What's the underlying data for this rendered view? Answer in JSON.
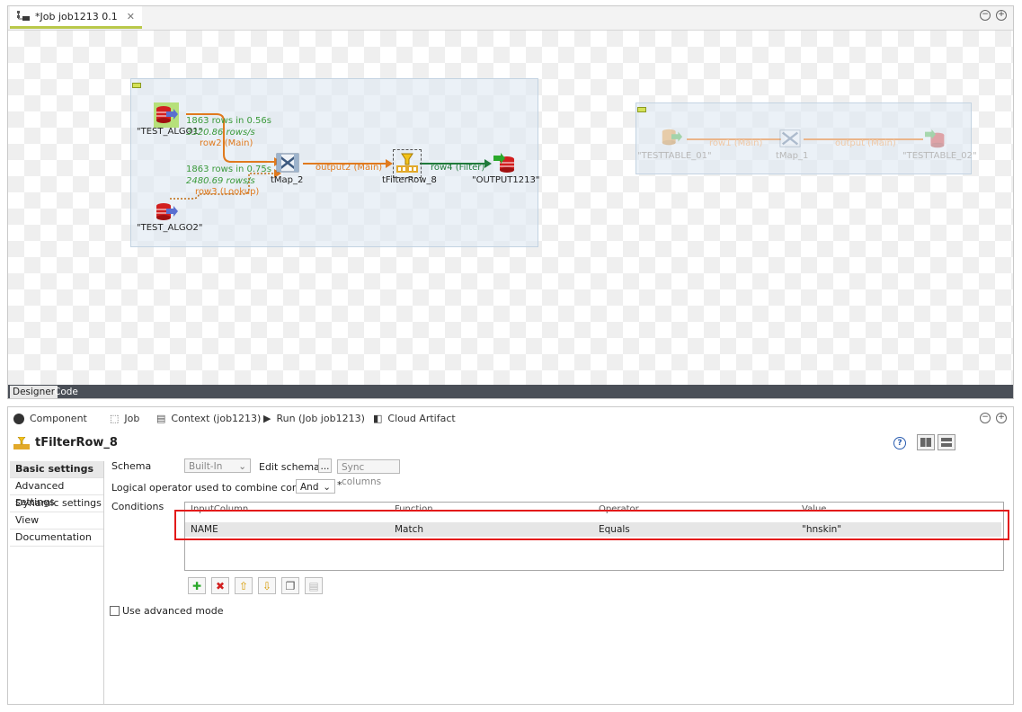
{
  "editor": {
    "tab_title": "*Job job1213 0.1",
    "bottom_tabs": [
      "Designer",
      "Code"
    ]
  },
  "job": {
    "nodes": {
      "test_algo1": "\"TEST_ALGO1\"",
      "test_algo2": "\"TEST_ALGO2\"",
      "tmap2": "tMap_2",
      "tfilterrow8": "tFilterRow_8",
      "output1213": "\"OUTPUT1213\"",
      "testtable01": "\"TESTTABLE_01\"",
      "tmap1": "tMap_1",
      "testtable02": "\"TESTTABLE_02\""
    },
    "flows": {
      "row2_stats": "1863 rows in 0.56s",
      "row2_rate": "3320.86 rows/s",
      "row2": "row2 (Main)",
      "row3_stats": "1863 rows in 0.75s",
      "row3_rate": "2480.69 rows/s",
      "row3": "row3 (Lookup)",
      "output2": "output2 (Main)",
      "row4": "row4 (Filter)",
      "row1": "row1 (Main)",
      "output": "output (Main)"
    }
  },
  "panel": {
    "tabs": [
      "Component",
      "Job",
      "Context (job1213)",
      "Run (Job job1213)",
      "Cloud Artifact"
    ],
    "component_title": "tFilterRow_8",
    "nav_items": [
      "Basic settings",
      "Advanced settings",
      "Dynamic settings",
      "View",
      "Documentation"
    ],
    "schema_label": "Schema",
    "schema_value": "Built-In",
    "edit_schema": "Edit schema",
    "edit_schema_btn": "...",
    "sync_columns": "Sync columns",
    "logical_operator_label": "Logical operator used to combine conditions",
    "logical_operator_value": "And",
    "asterisk": "*",
    "conditions_label": "Conditions",
    "table_headers": [
      "InputColumn",
      "Function",
      "Operator",
      "Value"
    ],
    "table_row": [
      "NAME",
      "Match",
      "Equals",
      "\"hnskin\""
    ],
    "use_advanced_mode": "Use advanced mode",
    "help": "?"
  },
  "colors": {
    "highlight": "#e31a1a",
    "tab_underline": "#b9c84a",
    "flow_orange": "#e07a1e",
    "flow_green": "#1f7a3a",
    "stats_green": "#3b9a3b"
  }
}
